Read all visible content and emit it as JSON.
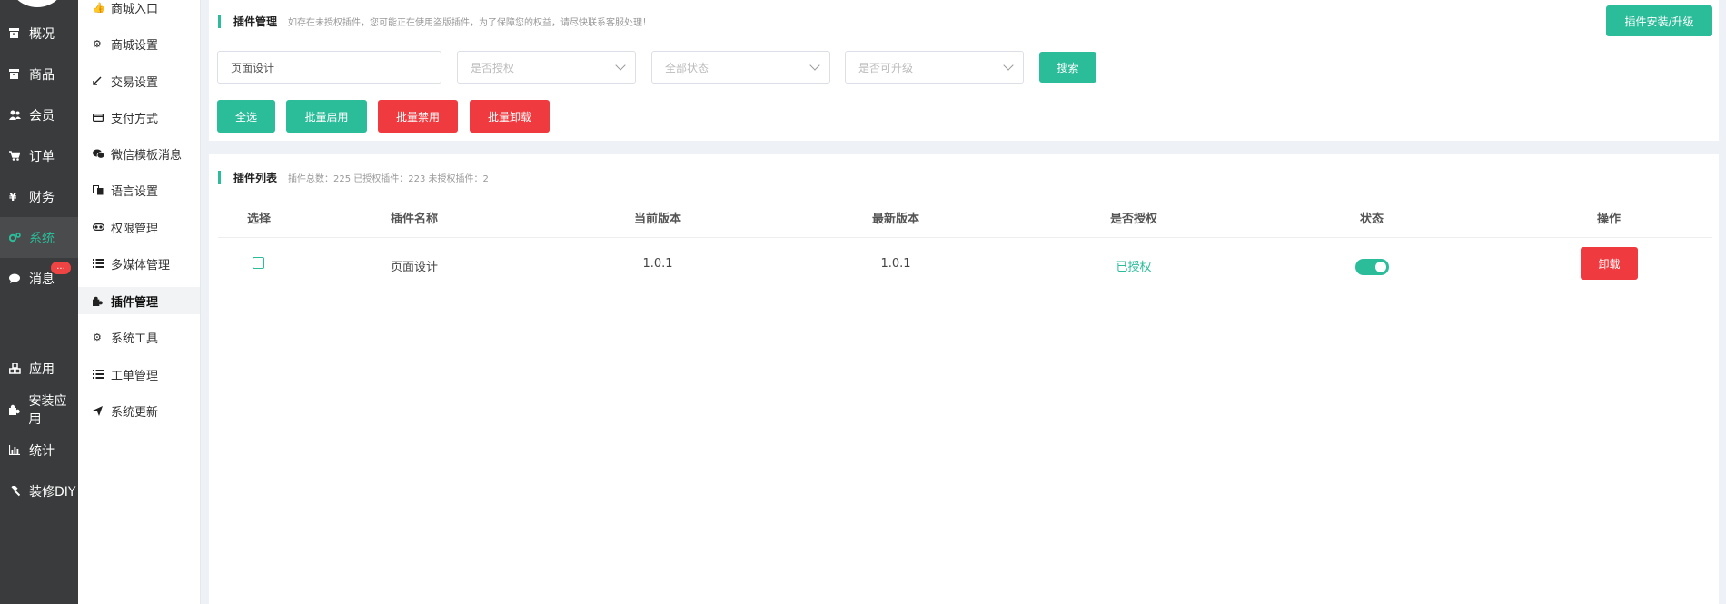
{
  "sidebar": {
    "items": [
      {
        "id": "overview",
        "label": "概况",
        "icon": "archive-icon"
      },
      {
        "id": "goods",
        "label": "商品",
        "icon": "archive-icon"
      },
      {
        "id": "members",
        "label": "会员",
        "icon": "users-icon"
      },
      {
        "id": "orders",
        "label": "订单",
        "icon": "cart-icon"
      },
      {
        "id": "finance",
        "label": "财务",
        "icon": "yen-icon"
      },
      {
        "id": "system",
        "label": "系统",
        "icon": "gears-icon",
        "active": true
      },
      {
        "id": "messages",
        "label": "消息",
        "icon": "comment-icon",
        "badge": "..."
      },
      {
        "id": "apps",
        "label": "应用",
        "icon": "cubes-icon"
      },
      {
        "id": "install-apps",
        "label": "安装应用",
        "icon": "puzzle-icon"
      },
      {
        "id": "stats",
        "label": "统计",
        "icon": "bar-chart-icon"
      },
      {
        "id": "decorate",
        "label": "装修DIY",
        "icon": "gavel-icon"
      }
    ]
  },
  "subnav": {
    "items": [
      {
        "label": "商城入口",
        "icon": "thumbs-up-icon"
      },
      {
        "label": "商城设置",
        "icon": "gear-icon"
      },
      {
        "label": "交易设置",
        "icon": "compress-icon"
      },
      {
        "label": "支付方式",
        "icon": "credit-card-icon"
      },
      {
        "label": "微信模板消息",
        "icon": "wechat-icon"
      },
      {
        "label": "语言设置",
        "icon": "language-icon"
      },
      {
        "label": "权限管理",
        "icon": "key-icon"
      },
      {
        "label": "多媒体管理",
        "icon": "list-icon"
      },
      {
        "label": "插件管理",
        "icon": "puzzle-icon",
        "active": true
      },
      {
        "label": "系统工具",
        "icon": "gear-icon"
      },
      {
        "label": "工单管理",
        "icon": "list-icon"
      },
      {
        "label": "系统更新",
        "icon": "send-icon"
      }
    ]
  },
  "plugin_manage": {
    "title": "插件管理",
    "hint": "如存在未授权插件，您可能正在使用盗版插件，为了保障您的权益，请尽快联系客服处理！",
    "install_button": "插件安装/升级",
    "search_value": "页面设计",
    "filter_auth_placeholder": "是否授权",
    "filter_status_placeholder": "全部状态",
    "filter_upgrade_placeholder": "是否可升级",
    "search_button": "搜索",
    "select_all_button": "全选",
    "batch_enable_button": "批量启用",
    "batch_disable_button": "批量禁用",
    "batch_uninstall_button": "批量卸载"
  },
  "plugin_list": {
    "title": "插件列表",
    "summary": "插件总数：225 已授权插件：223 未授权插件：2",
    "columns": [
      "选择",
      "插件名称",
      "当前版本",
      "最新版本",
      "是否授权",
      "状态",
      "操作"
    ],
    "rows": [
      {
        "name": "页面设计",
        "current_version": "1.0.1",
        "latest_version": "1.0.1",
        "auth": "已授权",
        "enabled": true,
        "action": "卸载"
      }
    ]
  },
  "colors": {
    "accent": "#2bbc99",
    "danger": "#ef3a3f",
    "sidebar_bg": "#3a3b3c"
  }
}
